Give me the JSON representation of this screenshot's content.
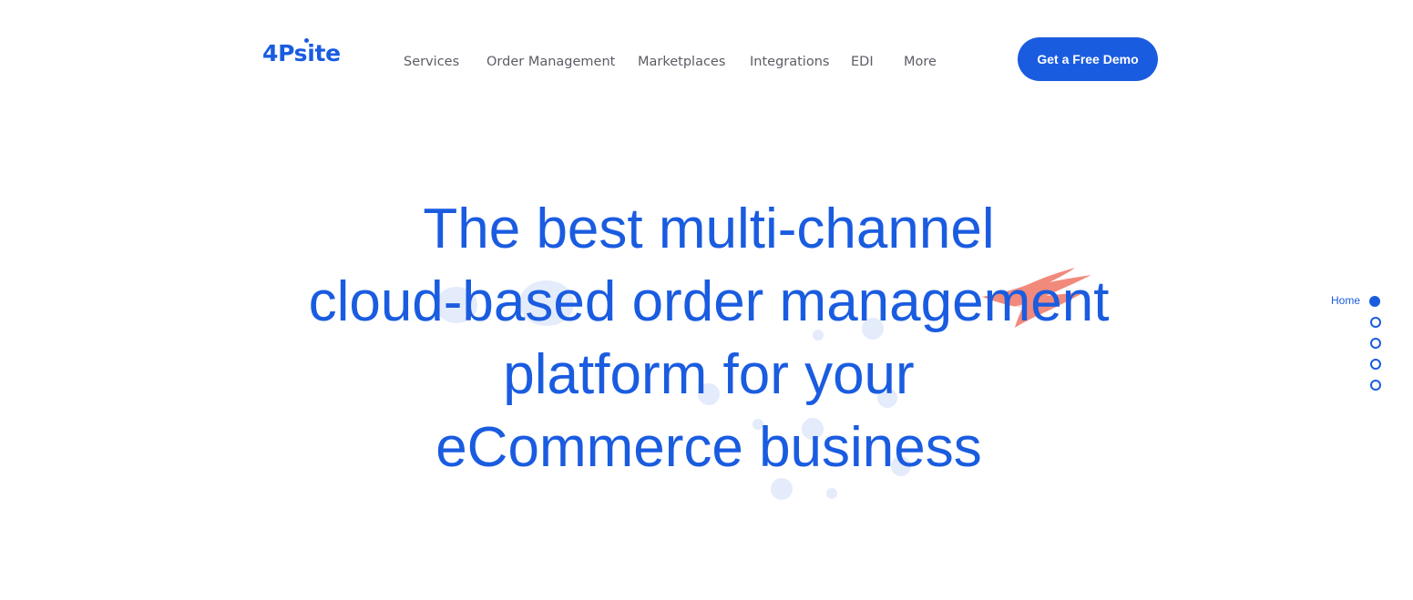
{
  "brand": {
    "logo_text": "4Psite",
    "color": "#1a5ce0"
  },
  "nav": {
    "items": [
      {
        "label": "Services"
      },
      {
        "label": "Order Management"
      },
      {
        "label": "Marketplaces"
      },
      {
        "label": "Integrations"
      },
      {
        "label": "EDI"
      },
      {
        "label": "More"
      }
    ]
  },
  "cta": {
    "label": "Get a Free Demo"
  },
  "hero": {
    "lines": [
      "The best multi-channel",
      "cloud-based order management",
      "platform for your",
      "eCommerce business"
    ]
  },
  "side_nav": {
    "active_label": "Home",
    "dot_count": 5,
    "active_index": 0
  },
  "colors": {
    "accent": "#1a5ce0",
    "nav_text": "#5c5c66",
    "brush": "#f08070"
  }
}
